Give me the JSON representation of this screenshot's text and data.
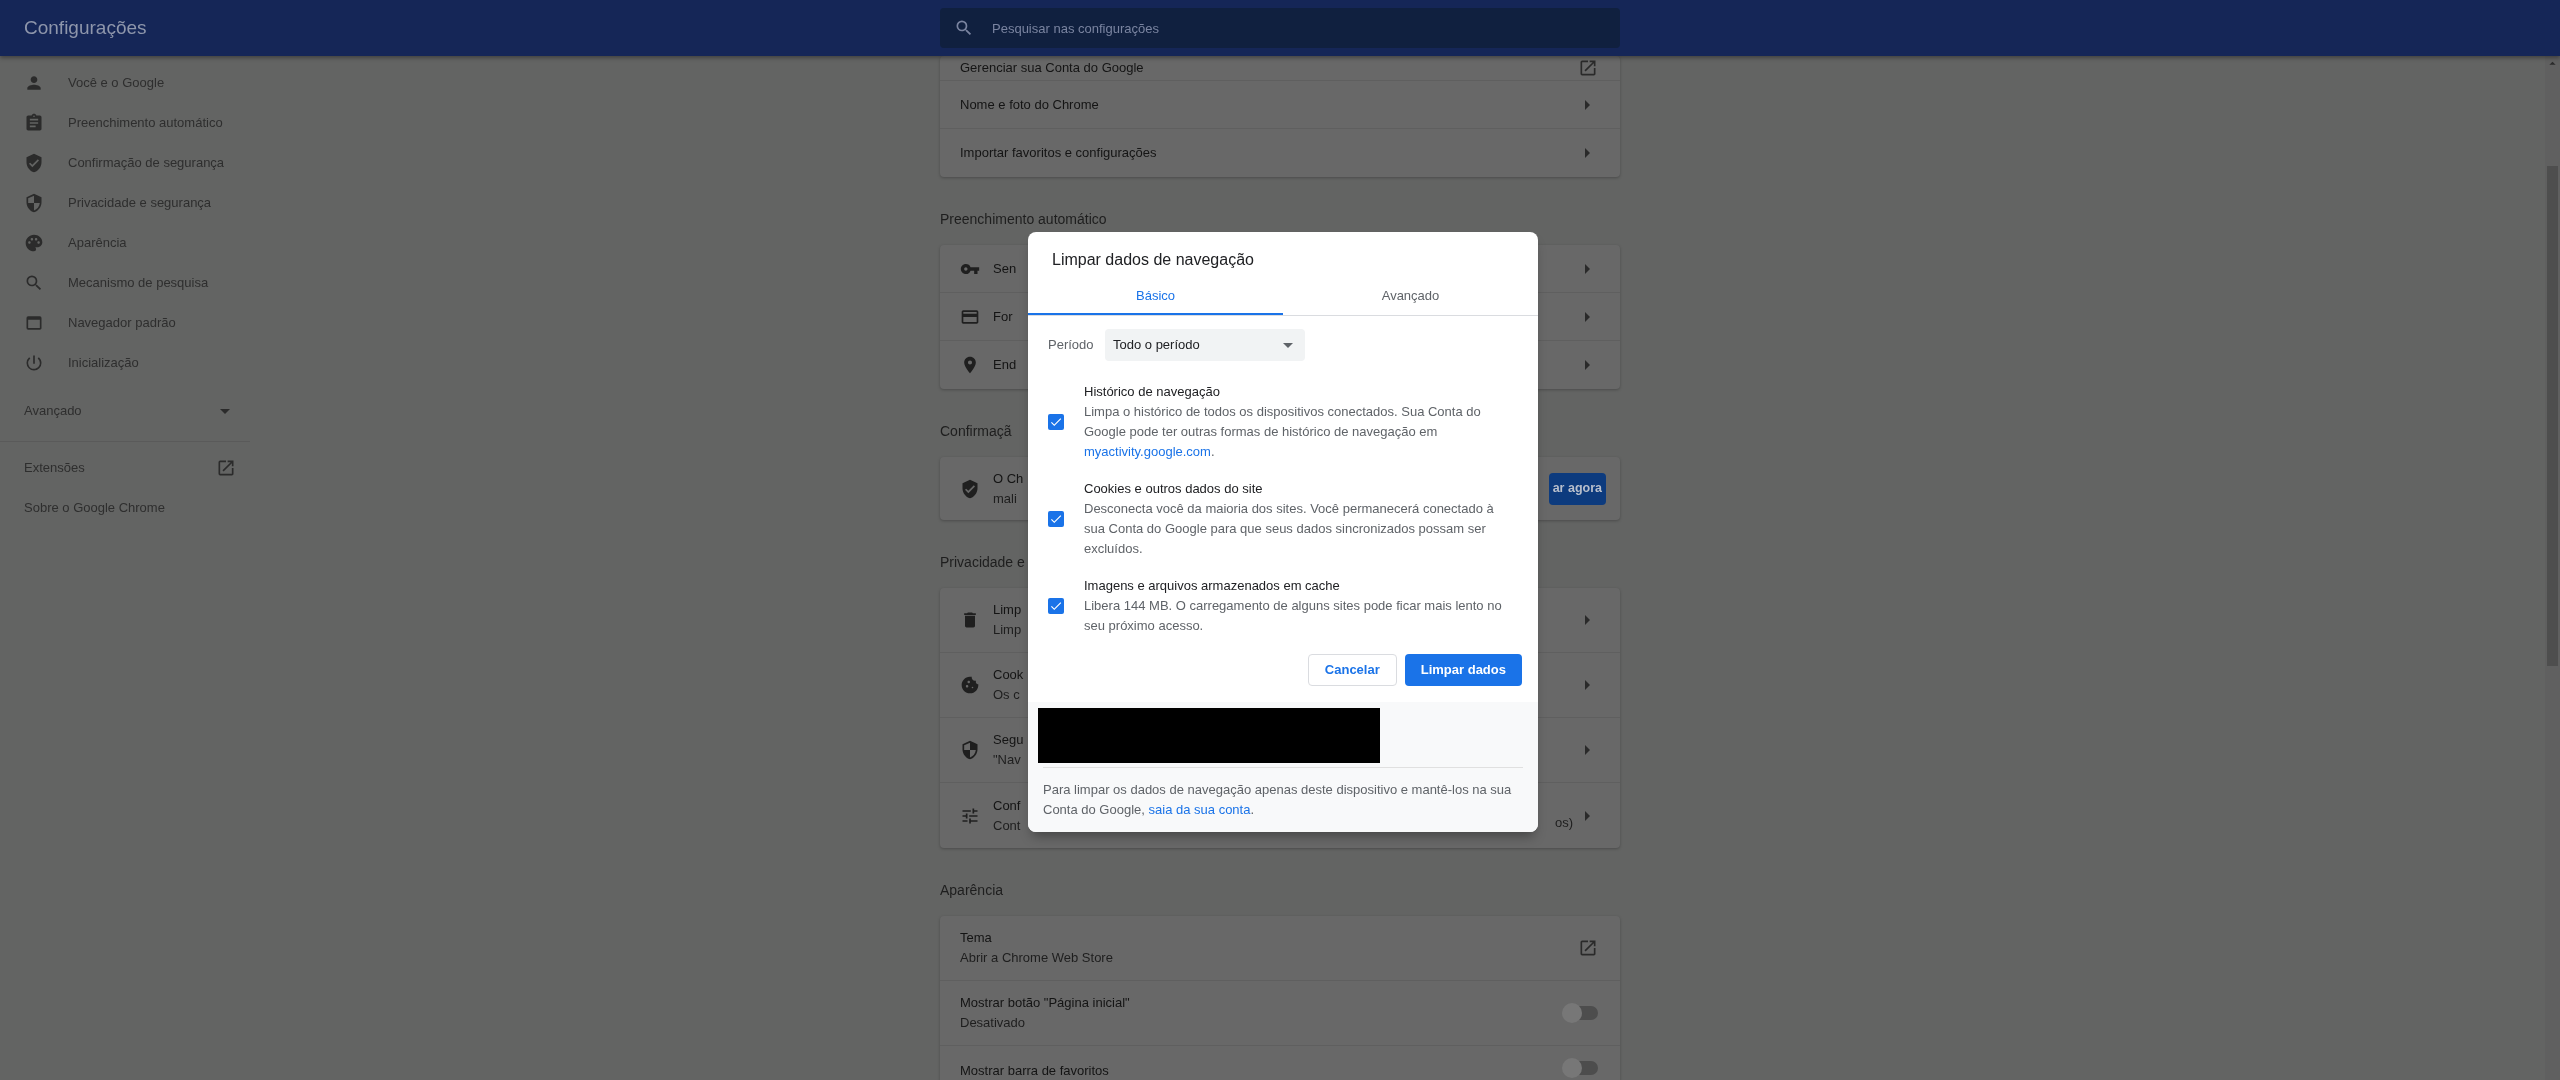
{
  "header": {
    "title": "Configurações",
    "search": {
      "placeholder": "Pesquisar nas configurações"
    }
  },
  "sidebar": {
    "items": [
      {
        "label": "Você e o Google"
      },
      {
        "label": "Preenchimento automático"
      },
      {
        "label": "Confirmação de segurança"
      },
      {
        "label": "Privacidade e segurança"
      },
      {
        "label": "Aparência"
      },
      {
        "label": "Mecanismo de pesquisa"
      },
      {
        "label": "Navegador padrão"
      },
      {
        "label": "Inicialização"
      }
    ],
    "advanced": {
      "label": "Avançado",
      "expanded": false
    },
    "links": [
      {
        "label": "Extensões",
        "kind": "external"
      },
      {
        "label": "Sobre o Google Chrome",
        "kind": "plain"
      }
    ]
  },
  "sections": [
    {
      "rows": [
        {
          "kind": "external",
          "title": "Gerenciar sua Conta do Google"
        },
        {
          "kind": "arrow",
          "title": "Nome e foto do Chrome"
        },
        {
          "kind": "arrow",
          "title": "Importar favoritos e configurações"
        }
      ]
    },
    {
      "heading": "Preenchimento automático",
      "rows": [
        {
          "kind": "arrow",
          "title": "Sen"
        },
        {
          "kind": "arrow",
          "title": "For"
        },
        {
          "kind": "arrow",
          "title": "End"
        }
      ]
    },
    {
      "heading": "Confirmaçã",
      "rows": [
        {
          "kind": "button",
          "title": "O Ch",
          "subtitle": "mali",
          "button": "ar agora"
        }
      ]
    },
    {
      "heading": "Privacidade e",
      "rows": [
        {
          "kind": "arrow",
          "title": "Limp",
          "subtitle": "Limp"
        },
        {
          "kind": "arrow",
          "title": "Cook",
          "subtitle": "Os c"
        },
        {
          "kind": "arrow",
          "title": "Segu",
          "subtitle": "\"Nav"
        },
        {
          "kind": "arrow",
          "title": "Conf",
          "subtitle": "Cont",
          "trailing": "os)"
        }
      ]
    },
    {
      "heading": "Aparência",
      "rows": [
        {
          "kind": "external",
          "title": "Tema",
          "subtitle": "Abrir a Chrome Web Store"
        },
        {
          "kind": "toggle",
          "title": "Mostrar botão \"Página inicial\"",
          "subtitle": "Desativado",
          "on": false
        },
        {
          "kind": "toggle",
          "title": "Mostrar barra de favoritos",
          "on": false
        }
      ]
    }
  ],
  "dialog": {
    "title": "Limpar dados de navegação",
    "tabs": [
      {
        "label": "Básico",
        "selected": true
      },
      {
        "label": "Avançado",
        "selected": false
      }
    ],
    "period": {
      "label": "Período",
      "value": "Todo o período"
    },
    "options": [
      {
        "title": "Histórico de navegação",
        "description": "Limpa o histórico de todos os dispositivos conectados. Sua Conta do Google pode ter outras formas de histórico de navegação em ",
        "link": "myactivity.google.com",
        "after": ".",
        "checked": true
      },
      {
        "title": "Cookies e outros dados do site",
        "description": "Desconecta você da maioria dos sites. Você permanecerá conectado à sua Conta do Google para que seus dados sincronizados possam ser excluídos.",
        "checked": true
      },
      {
        "title": "Imagens e arquivos armazenados em cache",
        "description": "Libera 144 MB. O carregamento de alguns sites pode ficar mais lento no seu próximo acesso.",
        "checked": true
      }
    ],
    "buttons": [
      {
        "label": "Cancelar",
        "kind": "secondary"
      },
      {
        "label": "Limpar dados",
        "kind": "primary"
      }
    ],
    "footer": {
      "text": "Para limpar os dados de navegação apenas deste dispositivo e mantê-los na sua Conta do Google, ",
      "link": "saia da sua conta",
      "after": "."
    }
  }
}
